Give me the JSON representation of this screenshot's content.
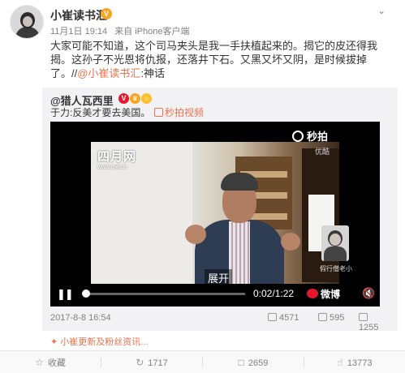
{
  "post": {
    "author": "小崔读书汇",
    "vip_badge": "V",
    "date": "11月1日 19:14",
    "source": "来自 iPhone客户端",
    "content_main": "大家可能不知道，这个司马夹头是我一手扶植起来的。揭它的皮还得我揭。这孙子不光恩将仇报，还落井下石。又黑又坏又阴，是时候拔掉了。//",
    "content_mention": "@小崔读书汇",
    "content_tail": ":神话"
  },
  "repost": {
    "author": "@猎人瓦西里",
    "badges": [
      "V",
      "♛",
      "☆"
    ],
    "text": "于力:反美才要去美国。",
    "link_label": "秒拍视频",
    "date": "2017-8-8 16:54",
    "repost_count": "4571",
    "comment_count": "595",
    "like_count": "1255"
  },
  "video": {
    "watermark_left": "四月网",
    "watermark_left_sub": "www.m4.cn",
    "brand": "秒拍",
    "brand_sub": "优酷",
    "expand_label": "展开",
    "thumb_caption": "假行僧老小",
    "play_icon": "pause-icon",
    "time": "0:02/1:22",
    "weibo_label": "微博",
    "mute_icon": "mute-icon",
    "progress": 0.02
  },
  "subline": {
    "text": "小崔更新及粉丝资讯..."
  },
  "actions": {
    "favorite": "收藏",
    "repost": "1717",
    "comment": "2659",
    "like": "13773"
  }
}
